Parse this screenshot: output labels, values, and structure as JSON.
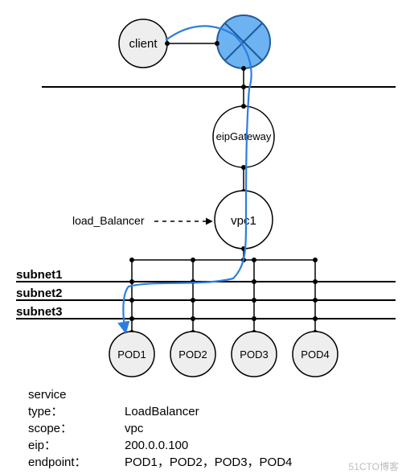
{
  "nodes": {
    "client": "client",
    "eipGateway": "eipGateway",
    "vpc": "vpc1",
    "loadBalancerLabel": "load_Balancer",
    "pods": [
      "POD1",
      "POD2",
      "POD3",
      "POD4"
    ]
  },
  "subnets": [
    "subnet1",
    "subnet2",
    "subnet3"
  ],
  "service": {
    "headerLabel": "service",
    "typeLabel": "type：",
    "typeValue": "LoadBalancer",
    "scopeLabel": "scope：",
    "scopeValue": "vpc",
    "eipLabel": "eip：",
    "eipValue": "200.0.0.100",
    "endpointLabel": "endpoint：",
    "endpointValue": "POD1，POD2，POD3，POD4"
  },
  "watermark": "51CTO博客",
  "colors": {
    "nodeFill": "#eeeeee",
    "nodeStroke": "#000000",
    "crossFill": "#6db3f2",
    "crossStroke": "#1f5b9c",
    "flow": "#2b7ee0"
  }
}
